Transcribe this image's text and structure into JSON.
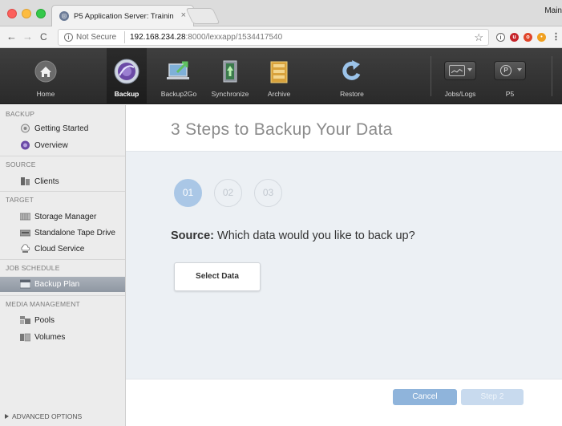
{
  "browser": {
    "tab_title": "P5 Application Server: Training",
    "tab_close": "×",
    "profile": "Main",
    "security_label": "Not Secure",
    "url_host": "192.168.234.28",
    "url_rest": ":8000/lexxapp/1534417540"
  },
  "toolbar": {
    "items": [
      {
        "label": "Home",
        "icon": "home-icon"
      },
      {
        "label": "Backup",
        "icon": "backup-icon",
        "active": true
      },
      {
        "label": "Backup2Go",
        "icon": "backup2go-icon"
      },
      {
        "label": "Synchronize",
        "icon": "synchronize-icon"
      },
      {
        "label": "Archive",
        "icon": "archive-icon"
      },
      {
        "label": "Restore",
        "icon": "restore-icon"
      },
      {
        "label": "Jobs/Logs",
        "icon": "jobs-logs-icon"
      },
      {
        "label": "P5",
        "icon": "p5-icon"
      }
    ]
  },
  "sidebar": {
    "sections": {
      "backup": "BACKUP",
      "source": "SOURCE",
      "target": "TARGET",
      "job_schedule": "JOB SCHEDULE",
      "media_management": "MEDIA MANAGEMENT"
    },
    "items": {
      "getting_started": "Getting Started",
      "overview": "Overview",
      "clients": "Clients",
      "storage_manager": "Storage Manager",
      "standalone_tape_drive": "Standalone Tape Drive",
      "cloud_service": "Cloud Service",
      "backup_plan": "Backup Plan",
      "pools": "Pools",
      "volumes": "Volumes"
    },
    "selected": "backup_plan",
    "advanced_options": "ADVANCED OPTIONS"
  },
  "main": {
    "title": "3 Steps to Backup Your Data",
    "steps": [
      "01",
      "02",
      "03"
    ],
    "active_step": 1,
    "source_label": "Source:",
    "source_question": "Which data would you like to back up?",
    "select_button": "Select Data"
  },
  "footer": {
    "cancel": "Cancel",
    "next": "Step 2"
  },
  "colors": {
    "accent": "#8fb4db",
    "step_active": "#aac7e6",
    "toolbar_bg": "#2f2f2f",
    "sidebar_selected": "#9aa1ab"
  }
}
